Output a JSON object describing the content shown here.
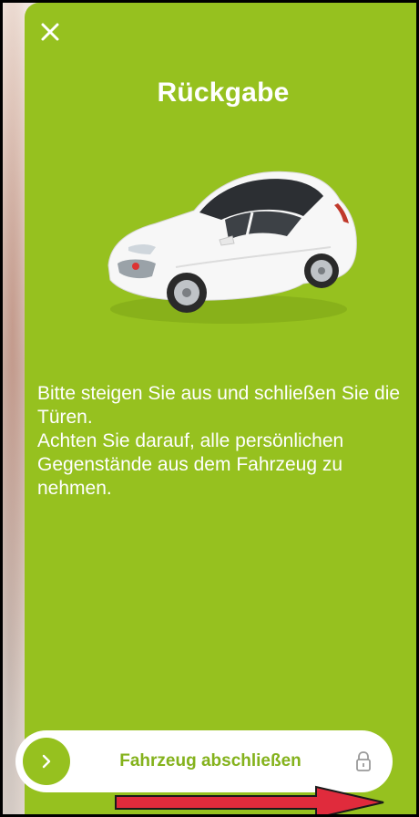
{
  "screen": {
    "close_icon": "close-icon",
    "title": "Rückgabe",
    "car_image": "white-hatchback-car"
  },
  "instructions": {
    "line1": "Bitte steigen Sie aus und schließen Sie die Türen.",
    "line2": "Achten Sie darauf, alle persönlichen Gegenstände aus dem Fahrzeug zu nehmen."
  },
  "lock_slider": {
    "label": "Fahrzeug abschließen",
    "knob_icon": "chevron-right-icon",
    "end_icon": "lock-icon"
  },
  "colors": {
    "accent": "#96c11f",
    "slider_text": "#84b21c",
    "annotation_arrow": "#e02b3c"
  }
}
